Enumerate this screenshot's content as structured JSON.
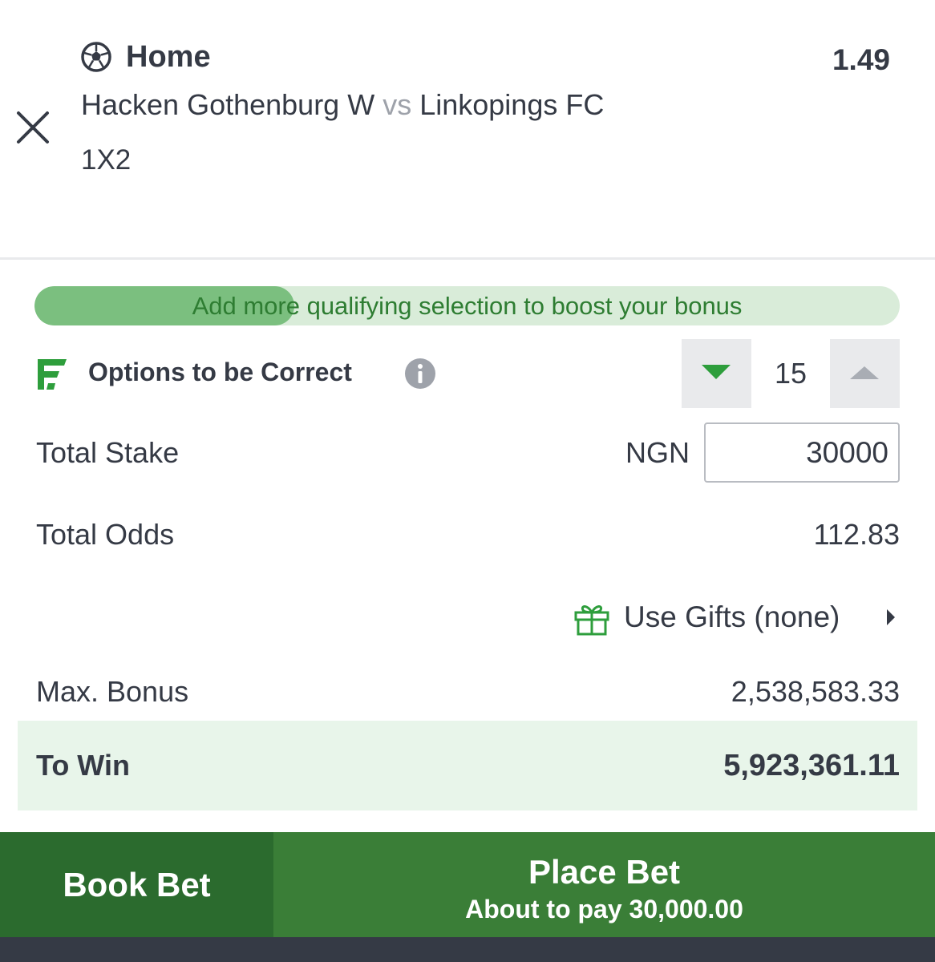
{
  "selection": {
    "pick": "Home",
    "odds": "1.49",
    "home_team": "Hacken Gothenburg W",
    "vs": "vs",
    "away_team": "Linkopings FC",
    "market": "1X2"
  },
  "bonus_progress": {
    "message": "Add more qualifying selection to boost your bonus",
    "fill_fraction": 0.3
  },
  "options": {
    "label": "Options to be Correct",
    "value": "15"
  },
  "stake": {
    "label": "Total Stake",
    "currency": "NGN",
    "value": "30000"
  },
  "total_odds": {
    "label": "Total Odds",
    "value": "112.83"
  },
  "gifts": {
    "label": "Use Gifts (none)"
  },
  "max_bonus": {
    "label": "Max. Bonus",
    "value": "2,538,583.33"
  },
  "to_win": {
    "label": "To Win",
    "value": "5,923,361.11"
  },
  "actions": {
    "book_bet": "Book Bet",
    "place_bet": "Place Bet",
    "place_bet_sub": "About to pay 30,000.00"
  },
  "colors": {
    "brand_green": "#3a7e37",
    "dark_green": "#2b6b2e",
    "progress_fill": "#7bbf7f",
    "progress_track": "#d9ecd9",
    "to_win_bg": "#e8f5ea",
    "text": "#353a45"
  }
}
